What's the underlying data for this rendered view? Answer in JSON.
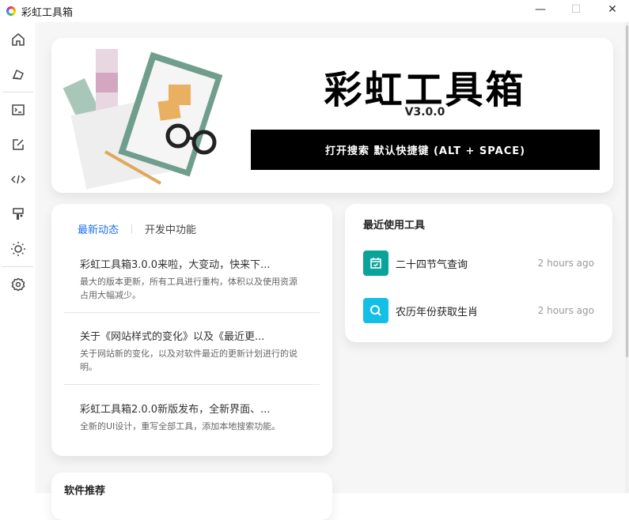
{
  "window": {
    "title": "彩虹工具箱",
    "minimize": "—",
    "maximize": "☐",
    "close": "✕"
  },
  "hero": {
    "title": "彩虹工具箱",
    "version": "V3.0.0",
    "search_label": "打开搜索 默认快捷键 (ALT + SPACE)"
  },
  "news": {
    "tabs": [
      "最新动态",
      "开发中功能"
    ],
    "items": [
      {
        "title": "彩虹工具箱3.0.0来啦，大变动，快来下...",
        "desc": "最大的版本更新，所有工具进行重构，体积以及使用资源占用大幅减少。"
      },
      {
        "title": "关于《网站样式的变化》以及《最近更...",
        "desc": "关于网站新的变化，以及对软件最近的更新计划进行的说明。"
      },
      {
        "title": "彩虹工具箱2.0.0新版发布，全新界面、...",
        "desc": "全新的UI设计，重写全部工具，添加本地搜索功能。"
      }
    ]
  },
  "recent": {
    "title": "最近使用工具",
    "items": [
      {
        "name": "二十四节气查询",
        "time": "2 hours ago",
        "icon": "calendar-check-icon",
        "color": "#0aa39a"
      },
      {
        "name": "农历年份获取生肖",
        "time": "2 hours ago",
        "icon": "search-icon",
        "color": "#14bfe6"
      }
    ]
  },
  "software": {
    "title": "软件推荐"
  }
}
